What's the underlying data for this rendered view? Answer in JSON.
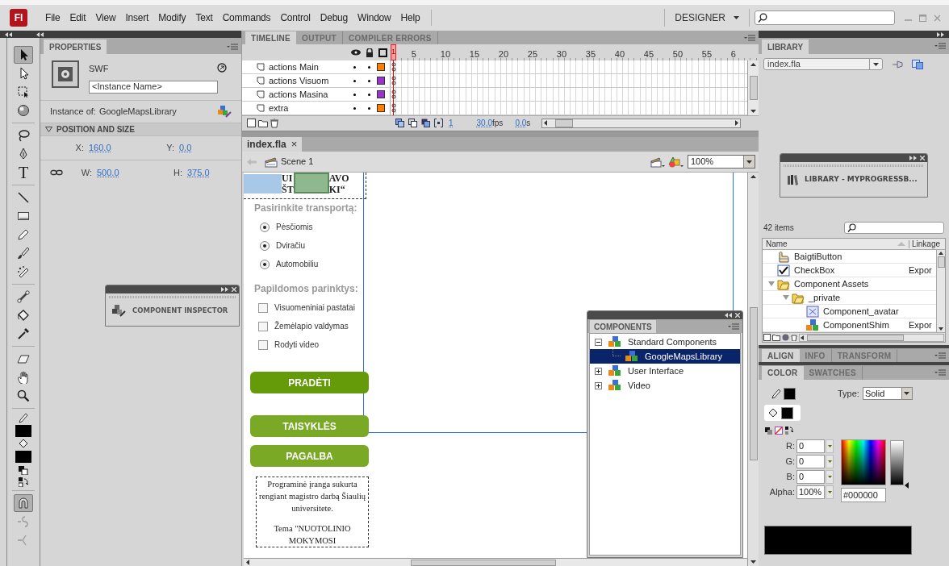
{
  "menubar": {
    "logo": "Fl",
    "menus": [
      "File",
      "Edit",
      "View",
      "Insert",
      "Modify",
      "Text",
      "Commands",
      "Control",
      "Debug",
      "Window",
      "Help"
    ],
    "workspace": "DESIGNER"
  },
  "tools": [
    {
      "kind": "selection",
      "selected": true
    },
    {
      "kind": "subselection",
      "selected": false
    },
    {
      "kind": "free-transform",
      "selected": false
    },
    {
      "kind": "rotation",
      "selected": false
    },
    {
      "kind": "lasso",
      "selected": false
    },
    {
      "kind": "pen",
      "selected": false
    },
    {
      "kind": "text",
      "glyph": "T",
      "selected": false
    },
    {
      "kind": "line",
      "selected": false
    },
    {
      "kind": "rectangle",
      "selected": false
    },
    {
      "kind": "pencil",
      "selected": false
    },
    {
      "kind": "brush",
      "selected": false
    },
    {
      "kind": "deco",
      "selected": false
    },
    {
      "kind": "bone",
      "selected": false
    },
    {
      "kind": "paint-bucket",
      "selected": false
    },
    {
      "kind": "eyedropper",
      "selected": false
    },
    {
      "kind": "eraser",
      "selected": false
    },
    {
      "kind": "hand",
      "selected": false
    },
    {
      "kind": "zoom",
      "selected": false
    },
    {
      "kind": "stroke-color",
      "color": "#000000"
    },
    {
      "kind": "fill-color",
      "color": "#000000"
    },
    {
      "kind": "swap-colors"
    },
    {
      "kind": "snap",
      "selected": true
    },
    {
      "kind": "smooth",
      "selected": false
    },
    {
      "kind": "straighten",
      "selected": false
    }
  ],
  "properties": {
    "tab": "PROPERTIES",
    "type": "SWF",
    "instance_name": {
      "placeholder": "<Instance Name>"
    },
    "instance_of_label": "Instance of:",
    "instance_of": "GoogleMapsLibrary",
    "section": {
      "title": "POSITION AND SIZE",
      "expanded": true
    },
    "fields": [
      {
        "label": "X:",
        "value": "160.0"
      },
      {
        "label": "Y:",
        "value": "0.0"
      },
      {
        "label": "W:",
        "value": "500.0"
      },
      {
        "label": "H:",
        "value": "375.0"
      }
    ]
  },
  "component_inspector": {
    "title": "COMPONENT INSPECTOR"
  },
  "timeline": {
    "tabs": [
      {
        "label": "TIMELINE",
        "selected": true
      },
      {
        "label": "OUTPUT",
        "selected": false
      },
      {
        "label": "COMPILER ERRORS",
        "selected": false
      }
    ],
    "playhead": "1",
    "frame_numbers": [
      "5",
      "10",
      "15",
      "20",
      "25",
      "30",
      "35",
      "40",
      "45",
      "50",
      "55",
      "6"
    ],
    "layers": [
      {
        "name": "actions Main",
        "color": "#ff8000"
      },
      {
        "name": "actions Visuom",
        "color": "#9933cc"
      },
      {
        "name": "actions Masina",
        "color": "#9933cc"
      },
      {
        "name": "extra",
        "color": "#ff8000"
      }
    ],
    "current_frame": "1",
    "fps": "30.0",
    "fps_unit": "fps",
    "time": "0.0",
    "time_unit": "s"
  },
  "document": {
    "tab": "index.fla",
    "close": "×",
    "scene": "Scene 1",
    "zoom": "100%"
  },
  "stage": {
    "heading_fragments": [
      "UI",
      "ŠT",
      "AVO",
      "KI“"
    ],
    "transport_label": "Pasirinkite transportą:",
    "transport_options": [
      {
        "label": "Pėsčiomis",
        "selected": true
      },
      {
        "label": "Dviračiu",
        "selected": true
      },
      {
        "label": "Automobiliu",
        "selected": true
      }
    ],
    "extras_label": "Papildomos parinktys:",
    "extras": [
      {
        "label": "Visuomeniniai pastatai",
        "checked": false
      },
      {
        "label": "Žemėlapio valdymas",
        "checked": false
      },
      {
        "label": "Rodyti video",
        "checked": false
      }
    ],
    "buttons": [
      {
        "label": "PRADĖTI",
        "kind": "primary"
      },
      {
        "label": "TAISYKLĖS",
        "kind": "secondary"
      },
      {
        "label": "PAGALBA",
        "kind": "secondary"
      }
    ],
    "note": [
      "Programinė įranga sukurta rengiant magistro darbą Šiaulių universitete.",
      "Tema \"NUOTOLINIO MOKYMOSI"
    ]
  },
  "components": {
    "tab": "COMPONENTS",
    "tree": [
      {
        "label": "Standard Components",
        "expanded": true,
        "selected": false,
        "children": [
          {
            "label": "GoogleMapsLibrary",
            "selected": true
          }
        ]
      },
      {
        "label": "User Interface",
        "expanded": false,
        "selected": false
      },
      {
        "label": "Video",
        "expanded": false,
        "selected": false
      }
    ]
  },
  "library": {
    "tab": "LIBRARY",
    "document": "index.fla",
    "floating_panel": "LIBRARY - MYPROGRESSB...",
    "count": "42 items",
    "columns": [
      "Name",
      "Linkage"
    ],
    "items": [
      {
        "name": "BaigtiButton",
        "kind": "button"
      },
      {
        "name": "CheckBox",
        "kind": "checkbox",
        "linkage": "Expor"
      },
      {
        "name": "Component Assets",
        "kind": "folder",
        "expanded": true,
        "children": [
          {
            "name": "_private",
            "kind": "folder",
            "expanded": true,
            "children": [
              {
                "name": "Component_avatar",
                "kind": "clip"
              },
              {
                "name": "ComponentShim",
                "kind": "component",
                "linkage": "Expor"
              }
            ]
          }
        ]
      }
    ]
  },
  "align_tabs": [
    {
      "label": "ALIGN",
      "selected": true
    },
    {
      "label": "INFO",
      "selected": false
    },
    {
      "label": "TRANSFORM",
      "selected": false
    }
  ],
  "color_tabs": [
    {
      "label": "COLOR",
      "selected": true
    },
    {
      "label": "SWATCHES",
      "selected": false
    }
  ],
  "color": {
    "type_label": "Type:",
    "type": "Solid",
    "channels": [
      {
        "label": "R:",
        "value": "0"
      },
      {
        "label": "G:",
        "value": "0"
      },
      {
        "label": "B:",
        "value": "0"
      },
      {
        "label": "Alpha:",
        "value": "100%"
      }
    ],
    "hex": "#000000"
  }
}
